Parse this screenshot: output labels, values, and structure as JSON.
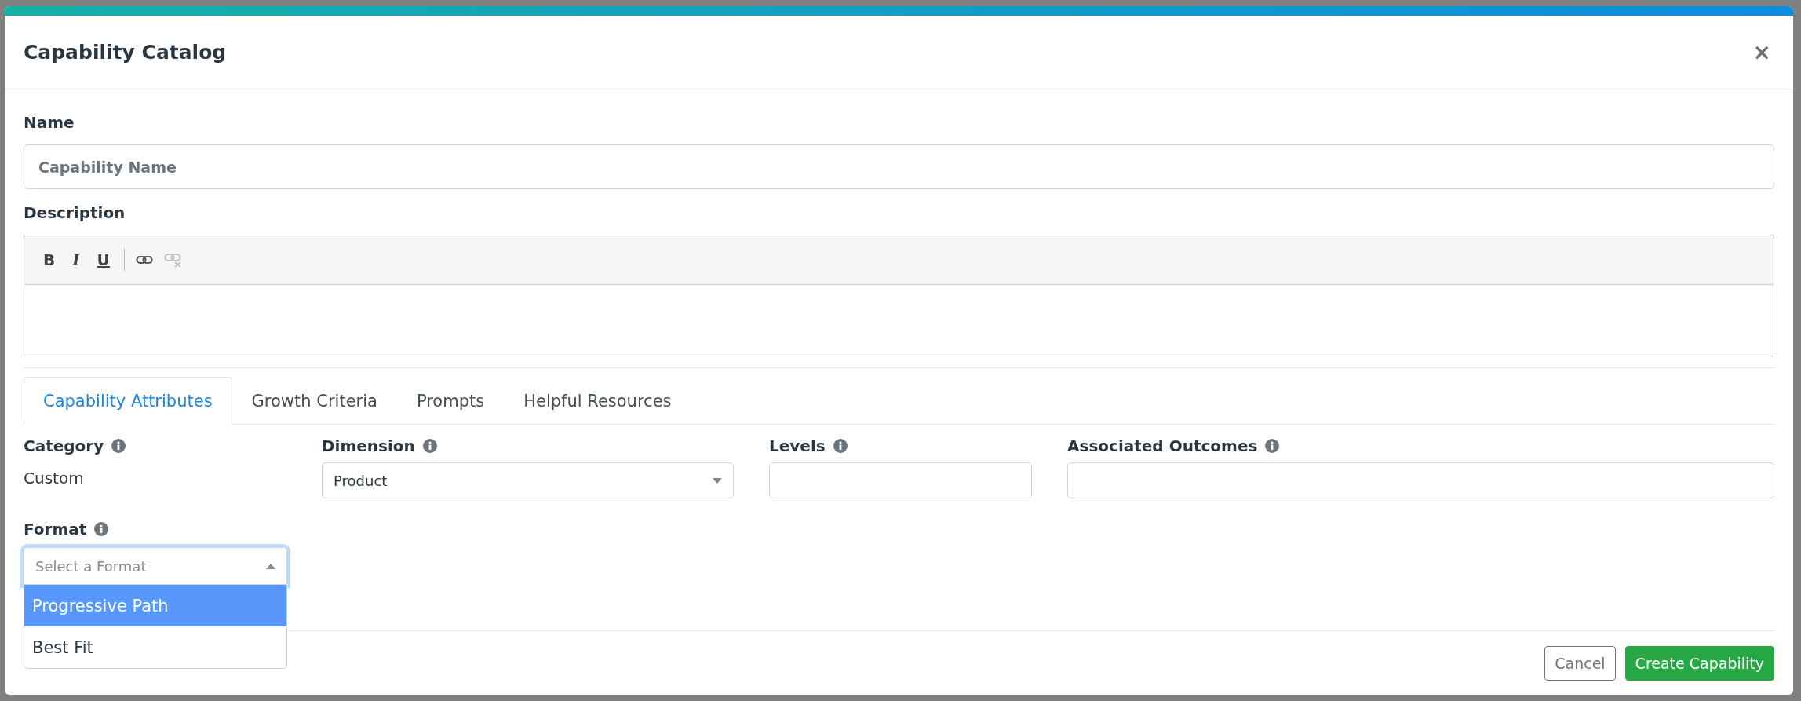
{
  "dialog": {
    "title": "Capability Catalog",
    "close": "×"
  },
  "name_field": {
    "label": "Name",
    "placeholder": "Capability Name"
  },
  "description": {
    "label": "Description",
    "toolbar": [
      {
        "kind": "bold",
        "label": "B"
      },
      {
        "kind": "italic",
        "label": "I"
      },
      {
        "kind": "underline",
        "label": "U"
      },
      {
        "kind": "separator"
      },
      {
        "kind": "link",
        "disabled": false
      },
      {
        "kind": "unlink",
        "disabled": true
      }
    ]
  },
  "tabs": [
    {
      "label": "Capability Attributes",
      "selected": true
    },
    {
      "label": "Growth Criteria",
      "selected": false
    },
    {
      "label": "Prompts",
      "selected": false
    },
    {
      "label": "Helpful Resources",
      "selected": false
    }
  ],
  "fields": [
    {
      "kind": "text",
      "label": "Category",
      "value": "Custom"
    },
    {
      "kind": "select",
      "label": "Dimension",
      "value": "Product"
    },
    {
      "kind": "input",
      "label": "Levels"
    },
    {
      "kind": "input",
      "label": "Associated Outcomes"
    }
  ],
  "format": {
    "label": "Format",
    "placeholder": "Select a Format",
    "expanded": true,
    "options": [
      {
        "label": "Progressive Path",
        "selected": true
      },
      {
        "label": "Best Fit",
        "selected": false
      }
    ]
  },
  "buttons": [
    {
      "kind": "secondary",
      "label": "Cancel"
    },
    {
      "kind": "primary",
      "label": "Create Capability"
    }
  ]
}
